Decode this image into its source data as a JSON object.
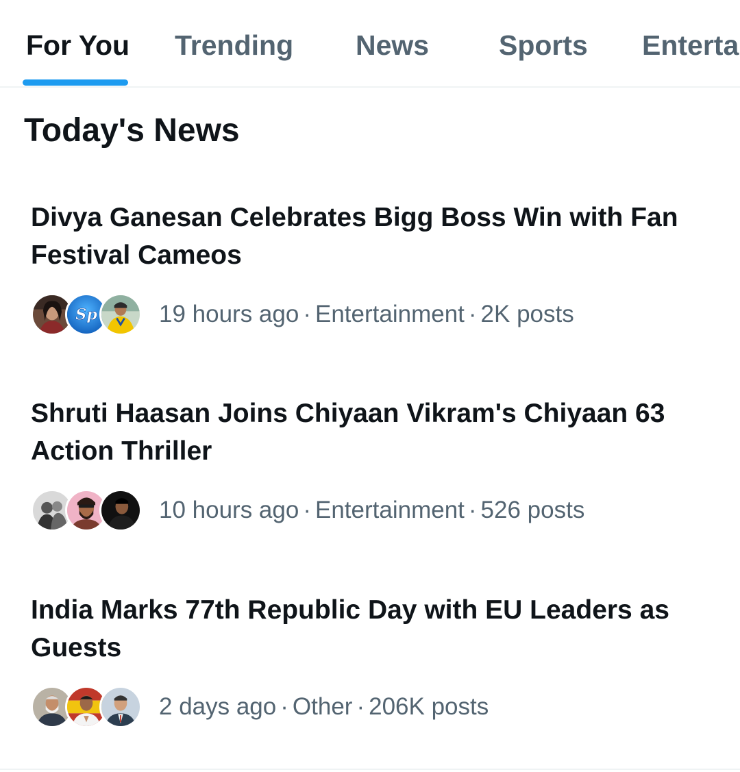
{
  "tabs": [
    {
      "label": "For You",
      "active": true
    },
    {
      "label": "Trending",
      "active": false
    },
    {
      "label": "News",
      "active": false
    },
    {
      "label": "Sports",
      "active": false
    },
    {
      "label": "Enterta",
      "active": false
    }
  ],
  "section_title": "Today's News",
  "stories": [
    {
      "title": "Divya Ganesan Celebrates Bigg Boss Win with Fan Festival Cameos",
      "time": "19 hours ago",
      "category": "Entertainment",
      "posts": "2K posts",
      "avatar_icons": [
        "woman-portrait-avatar-icon",
        "sp-logo-avatar-icon",
        "cricketer-yellow-jersey-avatar-icon"
      ],
      "sp_logo_text": "Sp"
    },
    {
      "title": "Shruti Haasan Joins Chiyaan Vikram's Chiyaan 63 Action Thriller",
      "time": "10 hours ago",
      "category": "Entertainment",
      "posts": "526 posts",
      "avatar_icons": [
        "bw-couple-avatar-icon",
        "bearded-man-avatar-icon",
        "man-dark-background-avatar-icon"
      ]
    },
    {
      "title": "India Marks 77th Republic Day with EU Leaders as Guests",
      "time": "2 days ago",
      "category": "Other",
      "posts": "206K posts",
      "avatar_icons": [
        "leader-avatar-icon",
        "man-namaste-flag-avatar-icon",
        "man-suit-avatar-icon"
      ]
    }
  ],
  "colors": {
    "accent": "#1d9bf0",
    "primary_text": "#0f1419",
    "secondary_text": "#536471",
    "divider": "#eff3f4"
  }
}
